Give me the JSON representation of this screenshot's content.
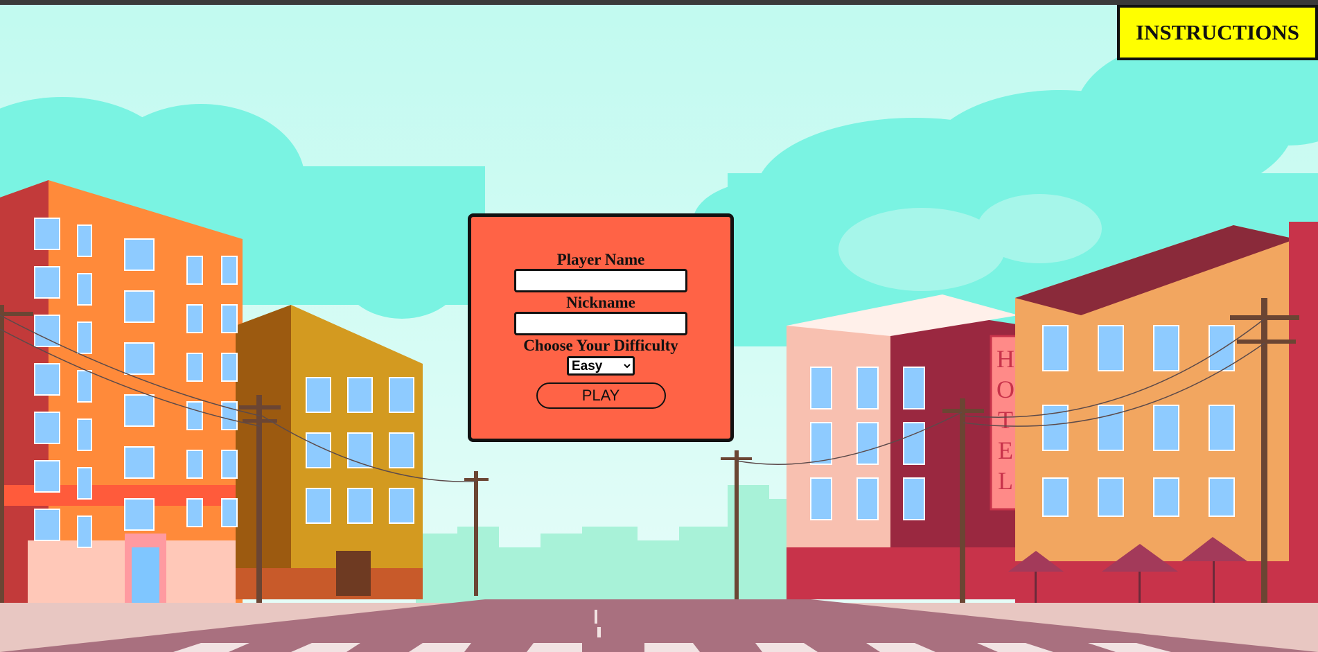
{
  "header": {
    "instructions_label": "INSTRUCTIONS"
  },
  "form": {
    "player_name_label": "Player Name",
    "player_name_value": "",
    "nickname_label": "Nickname",
    "nickname_value": "",
    "difficulty_label": "Choose Your Difficulty",
    "difficulty_selected": "Easy",
    "play_label": "PLAY"
  },
  "scene": {
    "hotel_sign": [
      "H",
      "O",
      "T",
      "E",
      "L"
    ]
  },
  "colors": {
    "sky": "#bff8ef",
    "clouds": "#7af3e2",
    "panel": "#ff6346",
    "instructions_bg": "#ffff00",
    "road": "#a9707f"
  }
}
